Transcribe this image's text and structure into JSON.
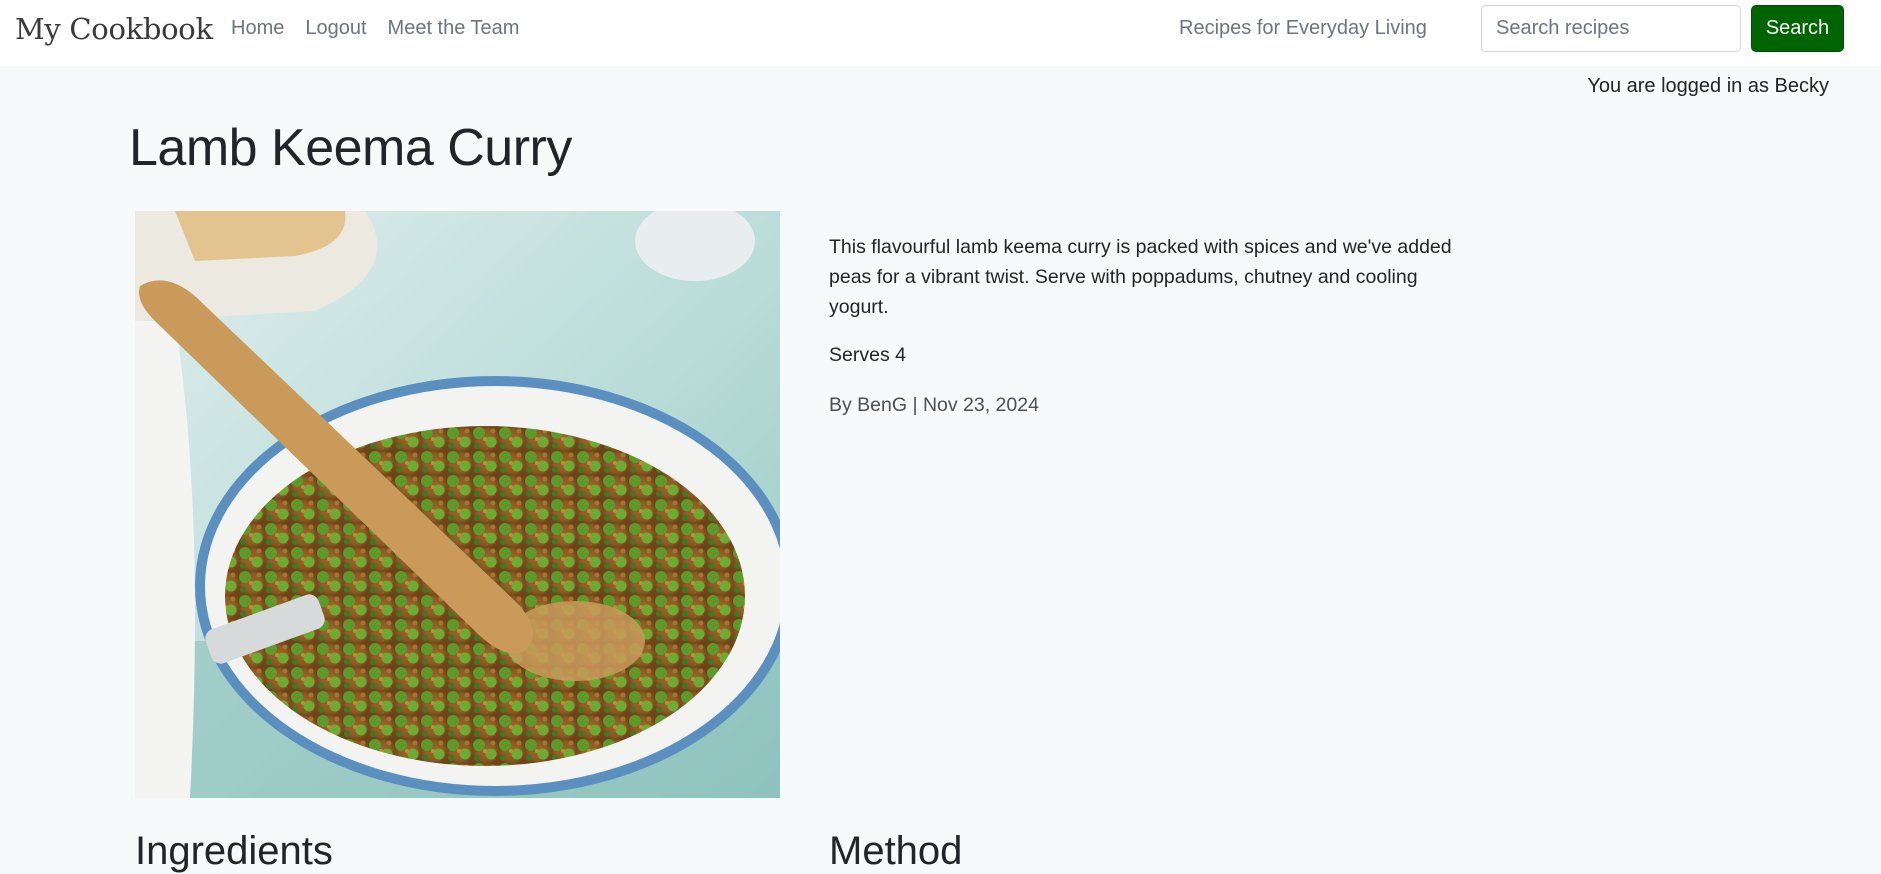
{
  "nav": {
    "brand": "My Cookbook",
    "links": [
      "Home",
      "Logout",
      "Meet the Team"
    ],
    "tagline": "Recipes for Everyday Living",
    "search_placeholder": "Search recipes",
    "search_label": "Search"
  },
  "status": {
    "logged_in": "You are logged in as Becky"
  },
  "recipe": {
    "title": "Lamb Keema Curry",
    "description": "This flavourful lamb keema curry is packed with spices and we've added peas for a vibrant twist. Serve with poppadums, chutney and cooling yogurt.",
    "serves": "Serves 4",
    "byline": "By BenG | Nov 23, 2024",
    "ingredients_heading": "Ingredients",
    "method_heading": "Method"
  },
  "colors": {
    "accent": "#006400",
    "background": "#f8f9fa",
    "navbar": "#ffffff"
  }
}
